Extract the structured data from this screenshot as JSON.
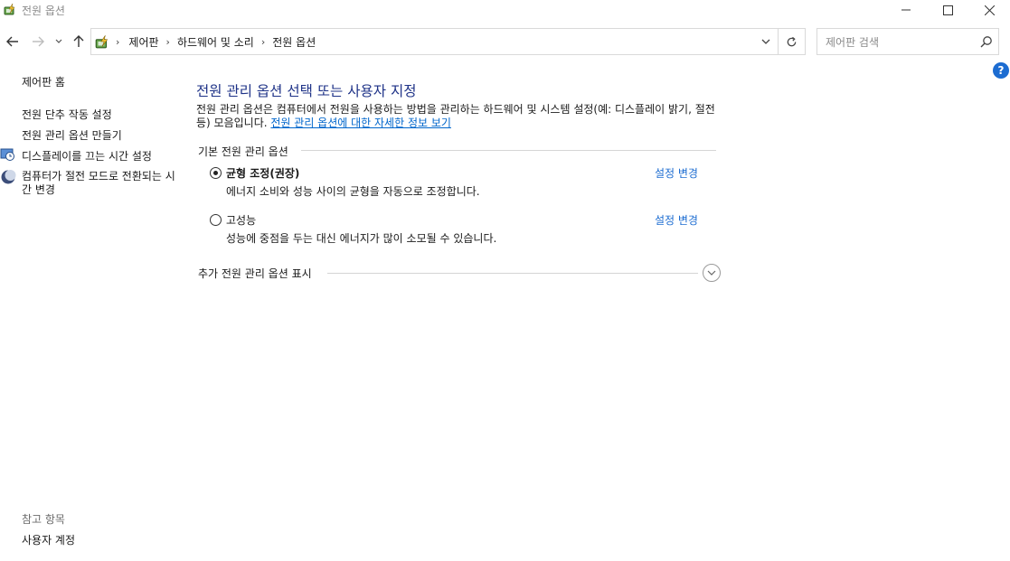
{
  "window": {
    "title": "전원 옵션"
  },
  "address": {
    "crumbs": [
      "제어판",
      "하드웨어 및 소리",
      "전원 옵션"
    ]
  },
  "search": {
    "placeholder": "제어판 검색"
  },
  "help": {
    "label": "?"
  },
  "sidebar": {
    "home": "제어판 홈",
    "links": [
      "전원 단추 작동 설정",
      "전원 관리 옵션 만들기",
      "디스플레이를 끄는 시간 설정",
      "컴퓨터가 절전 모드로 전환되는 시간 변경"
    ],
    "see_also_title": "참고 항목",
    "see_also_links": [
      "사용자 계정"
    ]
  },
  "main": {
    "title": "전원 관리 옵션 선택 또는 사용자 지정",
    "description": "전원 관리 옵션은 컴퓨터에서 전원을 사용하는 방법을 관리하는 하드웨어 및 시스템 설정(예: 디스플레이 밝기, 절전 등) 모음입니다.",
    "info_link": "전원 관리 옵션에 대한 자세한 정보 보기",
    "group_title": "기본 전원 관리 옵션",
    "plans": [
      {
        "name": "균형 조정(권장)",
        "description": "에너지 소비와 성능 사이의 균형을 자동으로 조정합니다.",
        "change_label": "설정 변경",
        "selected": true
      },
      {
        "name": "고성능",
        "description": "성능에 중점을 두는 대신 에너지가 많이 소모될 수 있습니다.",
        "change_label": "설정 변경",
        "selected": false
      }
    ],
    "more_label": "추가 전원 관리 옵션 표시"
  },
  "colors": {
    "title_blue": "#1e3287",
    "link_blue": "#0066cc",
    "help_blue": "#1c6cd1"
  }
}
